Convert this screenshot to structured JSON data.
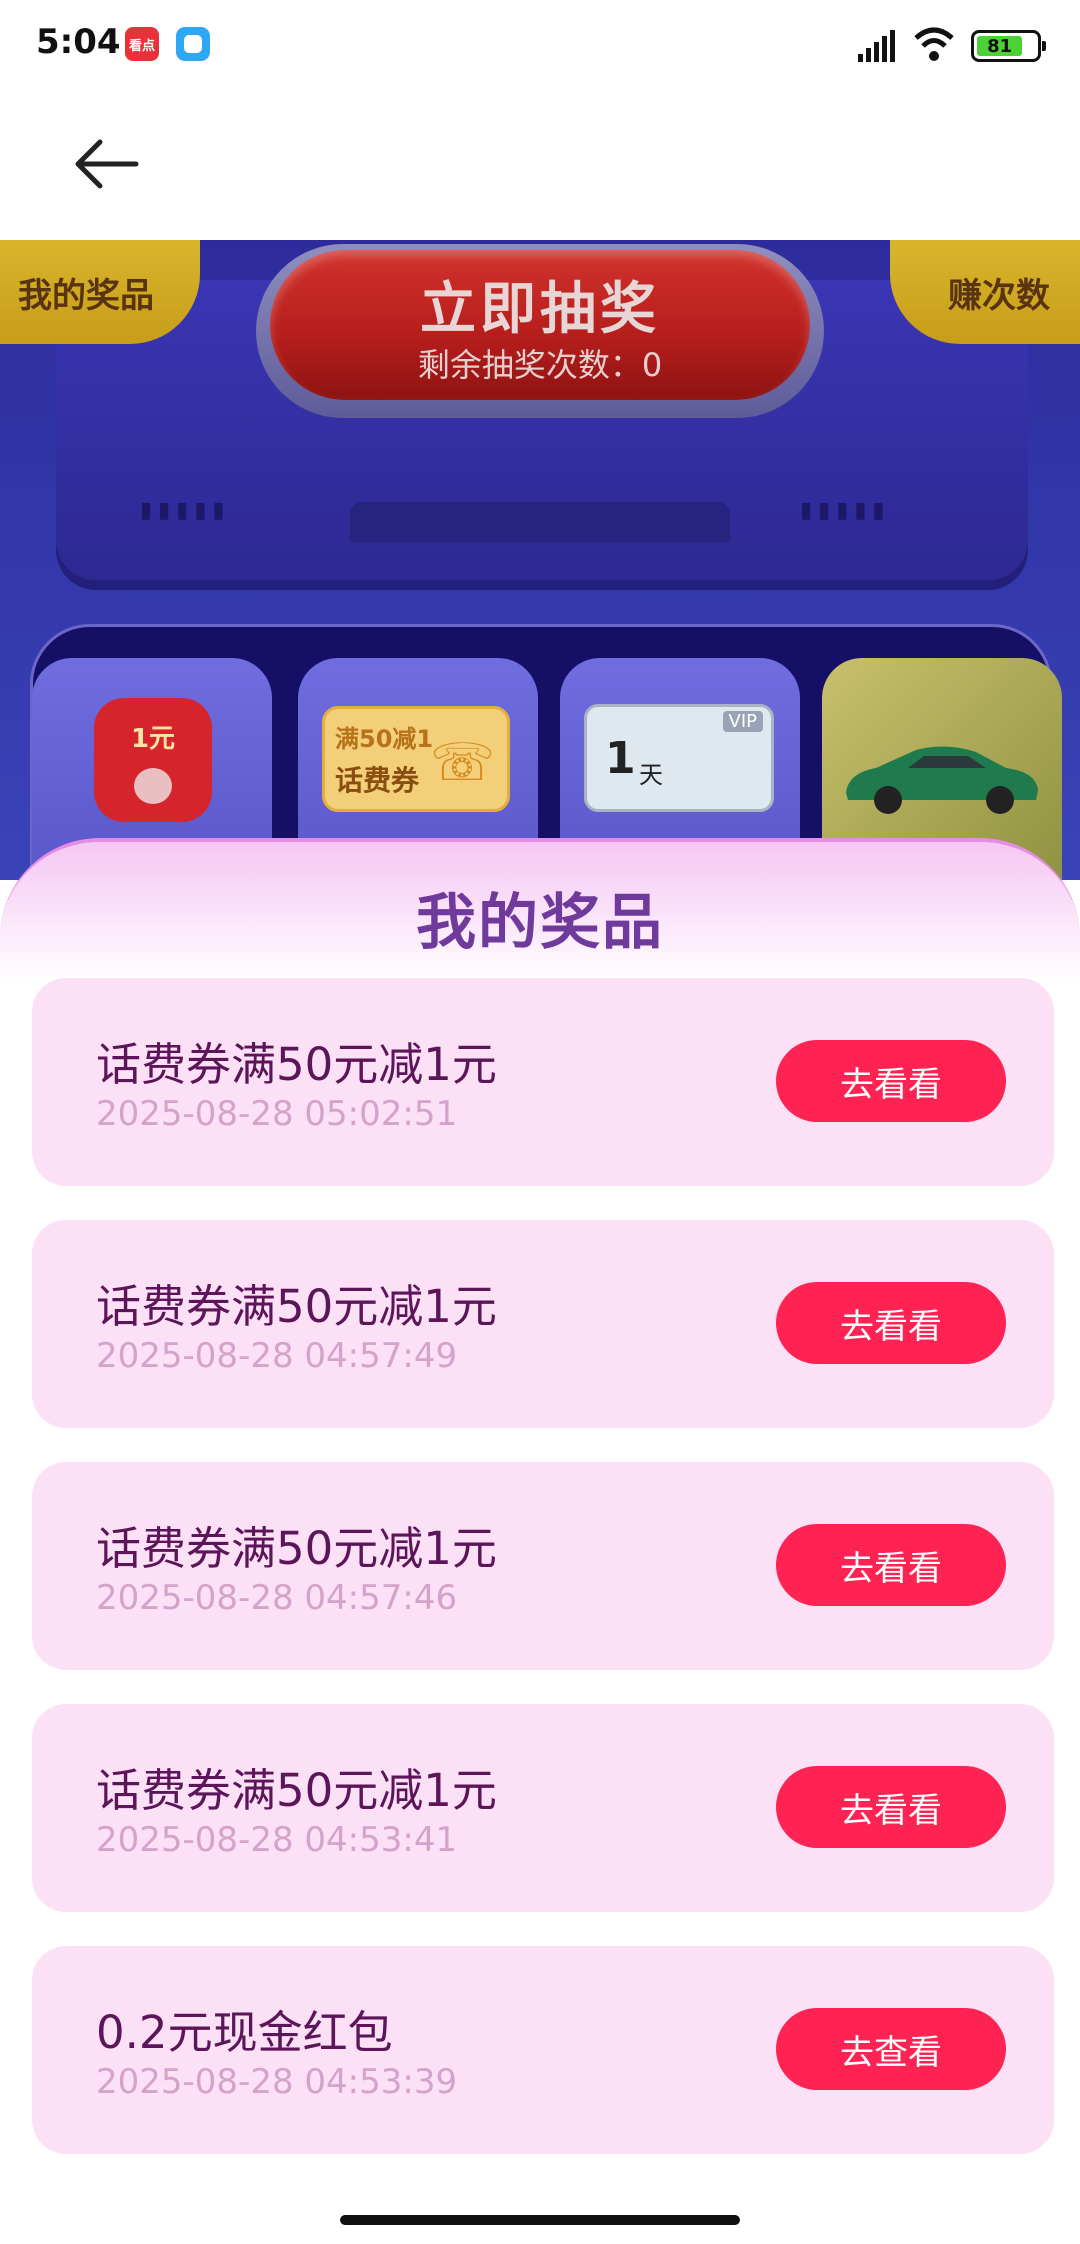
{
  "status_bar": {
    "time": "5:04",
    "app_icon_1_text": "看点",
    "battery": "81",
    "icons": [
      "app-red-icon",
      "app-blue-icon",
      "signal-icon",
      "wifi-icon",
      "battery-icon"
    ]
  },
  "nav": {
    "back_icon": "arrow-left-icon"
  },
  "lottery": {
    "my_prizes_tab": "我的奖品",
    "earn_tab": "赚次数",
    "draw_button": "立即抽奖",
    "remaining": "剩余抽奖次数：0",
    "prize_cards": [
      {
        "icon": "red-envelope-icon",
        "label": "1元"
      },
      {
        "icon": "coupon-icon",
        "line1": "满50减1",
        "line2": "话费券"
      },
      {
        "icon": "vip-card-icon",
        "value": "1",
        "unit": "天",
        "tag": "VIP"
      },
      {
        "icon": "car-icon"
      }
    ]
  },
  "sheet": {
    "title": "我的奖品",
    "items": [
      {
        "name": "话费券满50元减1元",
        "time": "2025-08-28 05:02:51",
        "button": "去看看"
      },
      {
        "name": "话费券满50元减1元",
        "time": "2025-08-28 04:57:49",
        "button": "去看看"
      },
      {
        "name": "话费券满50元减1元",
        "time": "2025-08-28 04:57:46",
        "button": "去看看"
      },
      {
        "name": "话费券满50元减1元",
        "time": "2025-08-28 04:53:41",
        "button": "去看看"
      },
      {
        "name": "0.2元现金红包",
        "time": "2025-08-28 04:53:39",
        "button": "去查看"
      }
    ]
  },
  "colors": {
    "accent": "#ff2353",
    "title": "#6f3a9c",
    "item_bg": "#fce0f6",
    "lottery_bg": "#3136a8"
  }
}
